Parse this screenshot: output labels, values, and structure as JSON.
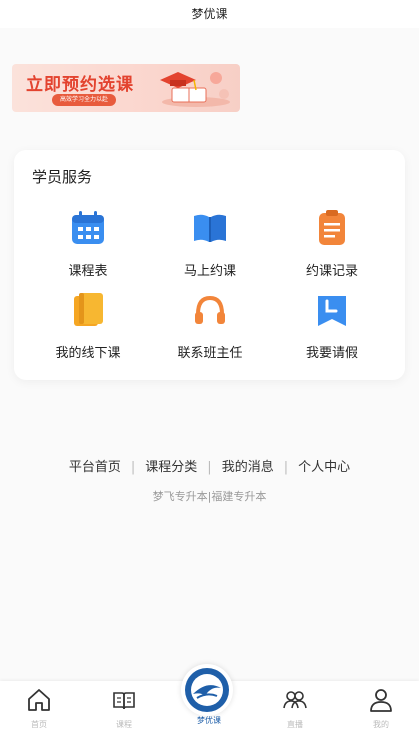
{
  "header": {
    "title": "梦优课"
  },
  "banner": {
    "title": "立即预约选课",
    "subtitle": "高效学习全力以赴"
  },
  "services": {
    "heading": "学员服务",
    "items": [
      {
        "label": "课程表",
        "icon": "calendar-icon",
        "color": "#3a8ef0"
      },
      {
        "label": "马上约课",
        "icon": "book-icon",
        "color": "#3a8ef0"
      },
      {
        "label": "约课记录",
        "icon": "clipboard-icon",
        "color": "#f2853a"
      },
      {
        "label": "我的线下课",
        "icon": "notebook-icon",
        "color": "#f5a623"
      },
      {
        "label": "联系班主任",
        "icon": "headset-icon",
        "color": "#f2853a"
      },
      {
        "label": "我要请假",
        "icon": "clock-bookmark-icon",
        "color": "#3a8ef0"
      }
    ]
  },
  "links": [
    "平台首页",
    "课程分类",
    "我的消息",
    "个人中心"
  ],
  "footer": {
    "text": "梦飞专升本|福建专升本"
  },
  "tabs": [
    {
      "label": "首页",
      "icon": "home-icon"
    },
    {
      "label": "课程",
      "icon": "open-book-icon"
    },
    {
      "label": "梦优课",
      "icon": "logo-icon",
      "active": true
    },
    {
      "label": "直播",
      "icon": "people-icon"
    },
    {
      "label": "我的",
      "icon": "user-icon"
    }
  ],
  "colors": {
    "accent": "#1f5fa9",
    "banner_red": "#e3432f",
    "orange": "#f2853a",
    "blue": "#3a8ef0"
  }
}
